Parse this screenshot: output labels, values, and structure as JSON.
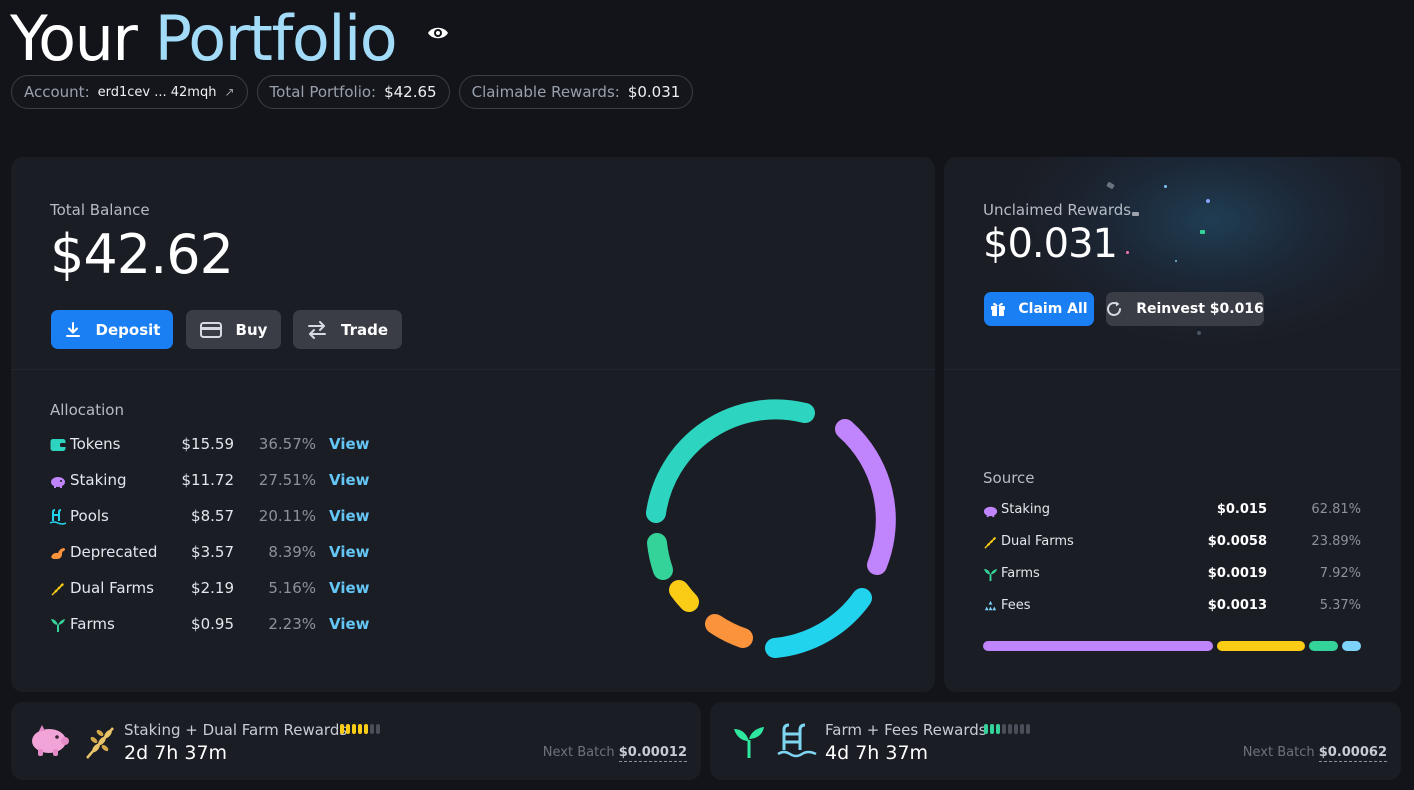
{
  "header": {
    "title_part1": "Your",
    "title_part2": "Portfolio",
    "account_label": "Account:",
    "account_value": "erd1cev ... 42mqh",
    "total_portfolio_label": "Total Portfolio:",
    "total_portfolio_value": "$42.65",
    "claimable_label": "Claimable Rewards:",
    "claimable_value": "$0.031"
  },
  "balance": {
    "label": "Total Balance",
    "value": "$42.62",
    "deposit": "Deposit",
    "buy": "Buy",
    "trade": "Trade"
  },
  "allocation": {
    "label": "Allocation",
    "view_label": "View",
    "rows": [
      {
        "name": "Tokens",
        "amount": "$15.59",
        "pct": "36.57%",
        "icon": "wallet-icon"
      },
      {
        "name": "Staking",
        "amount": "$11.72",
        "pct": "27.51%",
        "icon": "piggy-bank-icon"
      },
      {
        "name": "Pools",
        "amount": "$8.57",
        "pct": "20.11%",
        "icon": "pool-icon"
      },
      {
        "name": "Deprecated",
        "amount": "$3.57",
        "pct": "8.39%",
        "icon": "dino-icon"
      },
      {
        "name": "Dual Farms",
        "amount": "$2.19",
        "pct": "5.16%",
        "icon": "wheat-icon"
      },
      {
        "name": "Farms",
        "amount": "$0.95",
        "pct": "2.23%",
        "icon": "sprout-icon"
      }
    ],
    "donut_colors": [
      "#2dd4bf",
      "#c084fc",
      "#22d3ee",
      "#fb923c",
      "#facc15",
      "#34d399"
    ]
  },
  "rewards": {
    "label": "Unclaimed Rewards",
    "value": "$0.031",
    "claim_all": "Claim All",
    "reinvest": "Reinvest $0.016"
  },
  "source": {
    "label": "Source",
    "rows": [
      {
        "name": "Staking",
        "amount": "$0.015",
        "pct": "62.81%",
        "icon": "piggy-bank-icon"
      },
      {
        "name": "Dual Farms",
        "amount": "$0.0058",
        "pct": "23.89%",
        "icon": "wheat-icon"
      },
      {
        "name": "Farms",
        "amount": "$0.0019",
        "pct": "7.92%",
        "icon": "sprout-icon"
      },
      {
        "name": "Fees",
        "amount": "$0.0013",
        "pct": "5.37%",
        "icon": "coins-icon"
      }
    ],
    "bar_colors": [
      "#c084fc",
      "#facc15",
      "#34d399",
      "#7dd3fc"
    ]
  },
  "batches": [
    {
      "title": "Staking + Dual Farm Rewards",
      "time": "2d 7h 37m",
      "next_label": "Next Batch",
      "next_value": "$0.00012",
      "filled": 5,
      "total": 7,
      "color": "#facc15"
    },
    {
      "title": "Farm + Fees Rewards",
      "time": "4d 7h 37m",
      "next_label": "Next Batch",
      "next_value": "$0.00062",
      "filled": 3,
      "total": 8,
      "color": "#34d399"
    }
  ],
  "colors": {
    "accent": "#1a7ff2",
    "link": "#64c6f5",
    "title_highlight": "#a3dcf8"
  }
}
